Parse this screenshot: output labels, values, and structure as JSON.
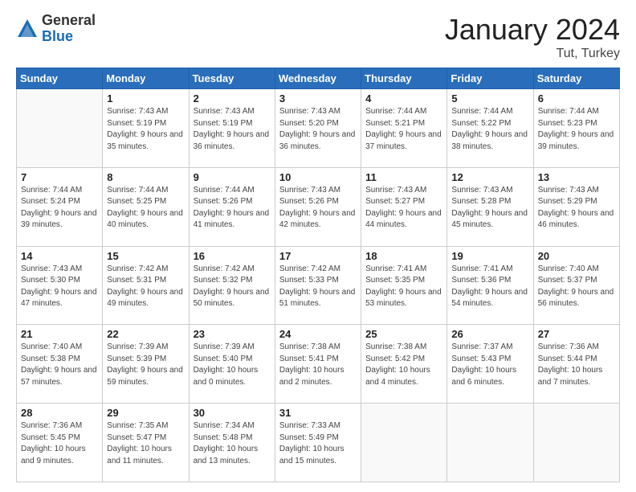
{
  "header": {
    "logo_general": "General",
    "logo_blue": "Blue",
    "month": "January 2024",
    "location": "Tut, Turkey"
  },
  "columns": [
    "Sunday",
    "Monday",
    "Tuesday",
    "Wednesday",
    "Thursday",
    "Friday",
    "Saturday"
  ],
  "weeks": [
    [
      {
        "day": "",
        "sunrise": "",
        "sunset": "",
        "daylight": ""
      },
      {
        "day": "1",
        "sunrise": "Sunrise: 7:43 AM",
        "sunset": "Sunset: 5:19 PM",
        "daylight": "Daylight: 9 hours and 35 minutes."
      },
      {
        "day": "2",
        "sunrise": "Sunrise: 7:43 AM",
        "sunset": "Sunset: 5:19 PM",
        "daylight": "Daylight: 9 hours and 36 minutes."
      },
      {
        "day": "3",
        "sunrise": "Sunrise: 7:43 AM",
        "sunset": "Sunset: 5:20 PM",
        "daylight": "Daylight: 9 hours and 36 minutes."
      },
      {
        "day": "4",
        "sunrise": "Sunrise: 7:44 AM",
        "sunset": "Sunset: 5:21 PM",
        "daylight": "Daylight: 9 hours and 37 minutes."
      },
      {
        "day": "5",
        "sunrise": "Sunrise: 7:44 AM",
        "sunset": "Sunset: 5:22 PM",
        "daylight": "Daylight: 9 hours and 38 minutes."
      },
      {
        "day": "6",
        "sunrise": "Sunrise: 7:44 AM",
        "sunset": "Sunset: 5:23 PM",
        "daylight": "Daylight: 9 hours and 39 minutes."
      }
    ],
    [
      {
        "day": "7",
        "sunrise": "Sunrise: 7:44 AM",
        "sunset": "Sunset: 5:24 PM",
        "daylight": "Daylight: 9 hours and 39 minutes."
      },
      {
        "day": "8",
        "sunrise": "Sunrise: 7:44 AM",
        "sunset": "Sunset: 5:25 PM",
        "daylight": "Daylight: 9 hours and 40 minutes."
      },
      {
        "day": "9",
        "sunrise": "Sunrise: 7:44 AM",
        "sunset": "Sunset: 5:26 PM",
        "daylight": "Daylight: 9 hours and 41 minutes."
      },
      {
        "day": "10",
        "sunrise": "Sunrise: 7:43 AM",
        "sunset": "Sunset: 5:26 PM",
        "daylight": "Daylight: 9 hours and 42 minutes."
      },
      {
        "day": "11",
        "sunrise": "Sunrise: 7:43 AM",
        "sunset": "Sunset: 5:27 PM",
        "daylight": "Daylight: 9 hours and 44 minutes."
      },
      {
        "day": "12",
        "sunrise": "Sunrise: 7:43 AM",
        "sunset": "Sunset: 5:28 PM",
        "daylight": "Daylight: 9 hours and 45 minutes."
      },
      {
        "day": "13",
        "sunrise": "Sunrise: 7:43 AM",
        "sunset": "Sunset: 5:29 PM",
        "daylight": "Daylight: 9 hours and 46 minutes."
      }
    ],
    [
      {
        "day": "14",
        "sunrise": "Sunrise: 7:43 AM",
        "sunset": "Sunset: 5:30 PM",
        "daylight": "Daylight: 9 hours and 47 minutes."
      },
      {
        "day": "15",
        "sunrise": "Sunrise: 7:42 AM",
        "sunset": "Sunset: 5:31 PM",
        "daylight": "Daylight: 9 hours and 49 minutes."
      },
      {
        "day": "16",
        "sunrise": "Sunrise: 7:42 AM",
        "sunset": "Sunset: 5:32 PM",
        "daylight": "Daylight: 9 hours and 50 minutes."
      },
      {
        "day": "17",
        "sunrise": "Sunrise: 7:42 AM",
        "sunset": "Sunset: 5:33 PM",
        "daylight": "Daylight: 9 hours and 51 minutes."
      },
      {
        "day": "18",
        "sunrise": "Sunrise: 7:41 AM",
        "sunset": "Sunset: 5:35 PM",
        "daylight": "Daylight: 9 hours and 53 minutes."
      },
      {
        "day": "19",
        "sunrise": "Sunrise: 7:41 AM",
        "sunset": "Sunset: 5:36 PM",
        "daylight": "Daylight: 9 hours and 54 minutes."
      },
      {
        "day": "20",
        "sunrise": "Sunrise: 7:40 AM",
        "sunset": "Sunset: 5:37 PM",
        "daylight": "Daylight: 9 hours and 56 minutes."
      }
    ],
    [
      {
        "day": "21",
        "sunrise": "Sunrise: 7:40 AM",
        "sunset": "Sunset: 5:38 PM",
        "daylight": "Daylight: 9 hours and 57 minutes."
      },
      {
        "day": "22",
        "sunrise": "Sunrise: 7:39 AM",
        "sunset": "Sunset: 5:39 PM",
        "daylight": "Daylight: 9 hours and 59 minutes."
      },
      {
        "day": "23",
        "sunrise": "Sunrise: 7:39 AM",
        "sunset": "Sunset: 5:40 PM",
        "daylight": "Daylight: 10 hours and 0 minutes."
      },
      {
        "day": "24",
        "sunrise": "Sunrise: 7:38 AM",
        "sunset": "Sunset: 5:41 PM",
        "daylight": "Daylight: 10 hours and 2 minutes."
      },
      {
        "day": "25",
        "sunrise": "Sunrise: 7:38 AM",
        "sunset": "Sunset: 5:42 PM",
        "daylight": "Daylight: 10 hours and 4 minutes."
      },
      {
        "day": "26",
        "sunrise": "Sunrise: 7:37 AM",
        "sunset": "Sunset: 5:43 PM",
        "daylight": "Daylight: 10 hours and 6 minutes."
      },
      {
        "day": "27",
        "sunrise": "Sunrise: 7:36 AM",
        "sunset": "Sunset: 5:44 PM",
        "daylight": "Daylight: 10 hours and 7 minutes."
      }
    ],
    [
      {
        "day": "28",
        "sunrise": "Sunrise: 7:36 AM",
        "sunset": "Sunset: 5:45 PM",
        "daylight": "Daylight: 10 hours and 9 minutes."
      },
      {
        "day": "29",
        "sunrise": "Sunrise: 7:35 AM",
        "sunset": "Sunset: 5:47 PM",
        "daylight": "Daylight: 10 hours and 11 minutes."
      },
      {
        "day": "30",
        "sunrise": "Sunrise: 7:34 AM",
        "sunset": "Sunset: 5:48 PM",
        "daylight": "Daylight: 10 hours and 13 minutes."
      },
      {
        "day": "31",
        "sunrise": "Sunrise: 7:33 AM",
        "sunset": "Sunset: 5:49 PM",
        "daylight": "Daylight: 10 hours and 15 minutes."
      },
      {
        "day": "",
        "sunrise": "",
        "sunset": "",
        "daylight": ""
      },
      {
        "day": "",
        "sunrise": "",
        "sunset": "",
        "daylight": ""
      },
      {
        "day": "",
        "sunrise": "",
        "sunset": "",
        "daylight": ""
      }
    ]
  ]
}
